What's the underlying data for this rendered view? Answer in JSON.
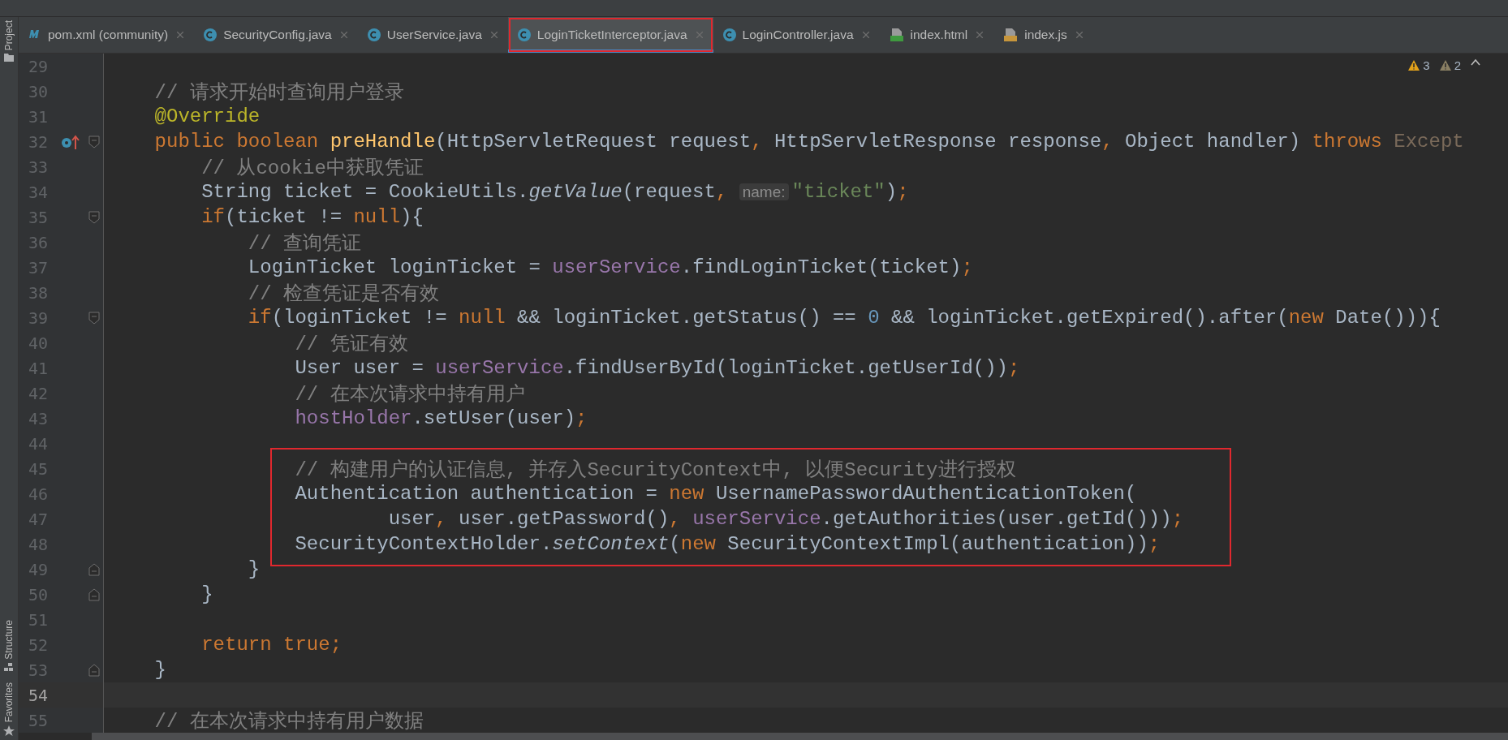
{
  "sidebar": {
    "top_items": [
      {
        "label": "Project",
        "kind": "folder"
      }
    ],
    "bottom_items": [
      {
        "label": "Structure",
        "kind": "structure"
      },
      {
        "label": "Favorites",
        "kind": "star"
      }
    ]
  },
  "tabs": [
    {
      "label": "pom.xml (community)",
      "kind": "maven",
      "selected": false
    },
    {
      "label": "SecurityConfig.java",
      "kind": "class",
      "selected": false
    },
    {
      "label": "UserService.java",
      "kind": "class",
      "selected": false
    },
    {
      "label": "LoginTicketInterceptor.java",
      "kind": "class",
      "selected": true
    },
    {
      "label": "LoginController.java",
      "kind": "class",
      "selected": false
    },
    {
      "label": "index.html",
      "kind": "html",
      "selected": false
    },
    {
      "label": "index.js",
      "kind": "js",
      "selected": false
    }
  ],
  "inspections": {
    "warnings": "3",
    "weak_warnings": "2"
  },
  "lines": [
    {
      "number": "29",
      "current": false,
      "boxed": false
    },
    {
      "number": "30",
      "current": false,
      "boxed": false,
      "segments": [
        {
          "text": "    // 请求开始时查询用户登录",
          "kind": "comment"
        }
      ]
    },
    {
      "number": "31",
      "current": false,
      "boxed": false,
      "segments": [
        {
          "text": "    @Override",
          "kind": "annotation"
        }
      ]
    },
    {
      "number": "32",
      "current": false,
      "boxed": false,
      "gutter_icon": {
        "kind": "implements"
      },
      "fold_marker": {
        "kind": "open"
      },
      "segments": [
        {
          "text": "    public boolean ",
          "kind": "keyword"
        },
        {
          "text": "preHandle",
          "kind": "method"
        },
        {
          "text": "(HttpServletRequest request",
          "kind": "plain"
        },
        {
          "text": ", ",
          "kind": "keyword"
        },
        {
          "text": "HttpServletResponse response",
          "kind": "plain"
        },
        {
          "text": ", ",
          "kind": "keyword"
        },
        {
          "text": "Object handler) ",
          "kind": "plain"
        },
        {
          "text": "throws ",
          "kind": "keyword"
        },
        {
          "text": "Except",
          "kind": "dim"
        }
      ]
    },
    {
      "number": "33",
      "current": false,
      "boxed": false,
      "segments": [
        {
          "text": "        // 从cookie中获取凭证",
          "kind": "comment"
        }
      ]
    },
    {
      "number": "34",
      "current": false,
      "boxed": false,
      "segments": [
        {
          "text": "        String ticket = CookieUtils.",
          "kind": "plain"
        },
        {
          "text": "getValue",
          "kind": "static"
        },
        {
          "text": "(request",
          "kind": "plain"
        },
        {
          "text": ", ",
          "kind": "keyword"
        },
        {
          "text": "name:",
          "kind": "hint"
        },
        {
          "text": "\"ticket\"",
          "kind": "string"
        },
        {
          "text": ")",
          "kind": "plain"
        },
        {
          "text": ";",
          "kind": "keyword"
        }
      ]
    },
    {
      "number": "35",
      "current": false,
      "boxed": false,
      "fold_marker": {
        "kind": "open"
      },
      "segments": [
        {
          "text": "        if",
          "kind": "keyword"
        },
        {
          "text": "(ticket != ",
          "kind": "plain"
        },
        {
          "text": "null",
          "kind": "keyword"
        },
        {
          "text": "){",
          "kind": "plain"
        }
      ]
    },
    {
      "number": "36",
      "current": false,
      "boxed": false,
      "segments": [
        {
          "text": "            // 查询凭证",
          "kind": "comment"
        }
      ]
    },
    {
      "number": "37",
      "current": false,
      "boxed": false,
      "segments": [
        {
          "text": "            LoginTicket loginTicket = ",
          "kind": "plain"
        },
        {
          "text": "userService",
          "kind": "field"
        },
        {
          "text": ".findLoginTicket(ticket)",
          "kind": "plain"
        },
        {
          "text": ";",
          "kind": "keyword"
        }
      ]
    },
    {
      "number": "38",
      "current": false,
      "boxed": false,
      "segments": [
        {
          "text": "            // 检查凭证是否有效",
          "kind": "comment"
        }
      ]
    },
    {
      "number": "39",
      "current": false,
      "boxed": false,
      "fold_marker": {
        "kind": "open"
      },
      "segments": [
        {
          "text": "            if",
          "kind": "keyword"
        },
        {
          "text": "(loginTicket != ",
          "kind": "plain"
        },
        {
          "text": "null ",
          "kind": "keyword"
        },
        {
          "text": "&& loginTicket.getStatus() == ",
          "kind": "plain"
        },
        {
          "text": "0 ",
          "kind": "number"
        },
        {
          "text": "&& loginTicket.getExpired().after(",
          "kind": "plain"
        },
        {
          "text": "new ",
          "kind": "keyword"
        },
        {
          "text": "Date())){",
          "kind": "plain"
        }
      ]
    },
    {
      "number": "40",
      "current": false,
      "boxed": false,
      "segments": [
        {
          "text": "                // 凭证有效",
          "kind": "comment"
        }
      ]
    },
    {
      "number": "41",
      "current": false,
      "boxed": false,
      "segments": [
        {
          "text": "                User user = ",
          "kind": "plain"
        },
        {
          "text": "userService",
          "kind": "field"
        },
        {
          "text": ".findUserById(loginTicket.getUserId())",
          "kind": "plain"
        },
        {
          "text": ";",
          "kind": "keyword"
        }
      ]
    },
    {
      "number": "42",
      "current": false,
      "boxed": false,
      "segments": [
        {
          "text": "                // 在本次请求中持有用户",
          "kind": "comment"
        }
      ]
    },
    {
      "number": "43",
      "current": false,
      "boxed": false,
      "segments": [
        {
          "text": "                hostHolder",
          "kind": "field"
        },
        {
          "text": ".setUser(user)",
          "kind": "plain"
        },
        {
          "text": ";",
          "kind": "keyword"
        }
      ]
    },
    {
      "number": "44",
      "current": false,
      "boxed": false
    },
    {
      "number": "45",
      "current": false,
      "boxed": true,
      "segments": [
        {
          "text": "                // 构建用户的认证信息, 并存入SecurityContext中, 以便Security进行授权",
          "kind": "comment"
        }
      ]
    },
    {
      "number": "46",
      "current": false,
      "boxed": true,
      "segments": [
        {
          "text": "                Authentication authentication = ",
          "kind": "plain"
        },
        {
          "text": "new ",
          "kind": "keyword"
        },
        {
          "text": "UsernamePasswordAuthenticationToken(",
          "kind": "plain"
        }
      ]
    },
    {
      "number": "47",
      "current": false,
      "boxed": true,
      "segments": [
        {
          "text": "                        user",
          "kind": "plain"
        },
        {
          "text": ", ",
          "kind": "keyword"
        },
        {
          "text": "user.getPassword()",
          "kind": "plain"
        },
        {
          "text": ", ",
          "kind": "keyword"
        },
        {
          "text": "userService",
          "kind": "field"
        },
        {
          "text": ".getAuthorities(user.getId()))",
          "kind": "plain"
        },
        {
          "text": ";",
          "kind": "keyword"
        }
      ]
    },
    {
      "number": "48",
      "current": false,
      "boxed": true,
      "segments": [
        {
          "text": "                SecurityContextHolder.",
          "kind": "plain"
        },
        {
          "text": "setContext",
          "kind": "static"
        },
        {
          "text": "(",
          "kind": "plain"
        },
        {
          "text": "new ",
          "kind": "keyword"
        },
        {
          "text": "SecurityContextImpl(authentication))",
          "kind": "plain"
        },
        {
          "text": ";",
          "kind": "keyword"
        }
      ]
    },
    {
      "number": "49",
      "current": false,
      "boxed": false,
      "fold_marker": {
        "kind": "close"
      },
      "segments": [
        {
          "text": "            }",
          "kind": "plain"
        }
      ]
    },
    {
      "number": "50",
      "current": false,
      "boxed": false,
      "fold_marker": {
        "kind": "close"
      },
      "segments": [
        {
          "text": "        }",
          "kind": "plain"
        }
      ]
    },
    {
      "number": "51",
      "current": false,
      "boxed": false
    },
    {
      "number": "52",
      "current": false,
      "boxed": false,
      "segments": [
        {
          "text": "        return true;",
          "kind": "keyword"
        }
      ]
    },
    {
      "number": "53",
      "current": false,
      "boxed": false,
      "fold_marker": {
        "kind": "close"
      },
      "segments": [
        {
          "text": "    }",
          "kind": "plain"
        }
      ]
    },
    {
      "number": "54",
      "current": true,
      "boxed": false
    },
    {
      "number": "55",
      "current": false,
      "boxed": false,
      "segments": [
        {
          "text": "    // 在本次请求中持有用户数据",
          "kind": "comment"
        }
      ]
    }
  ]
}
